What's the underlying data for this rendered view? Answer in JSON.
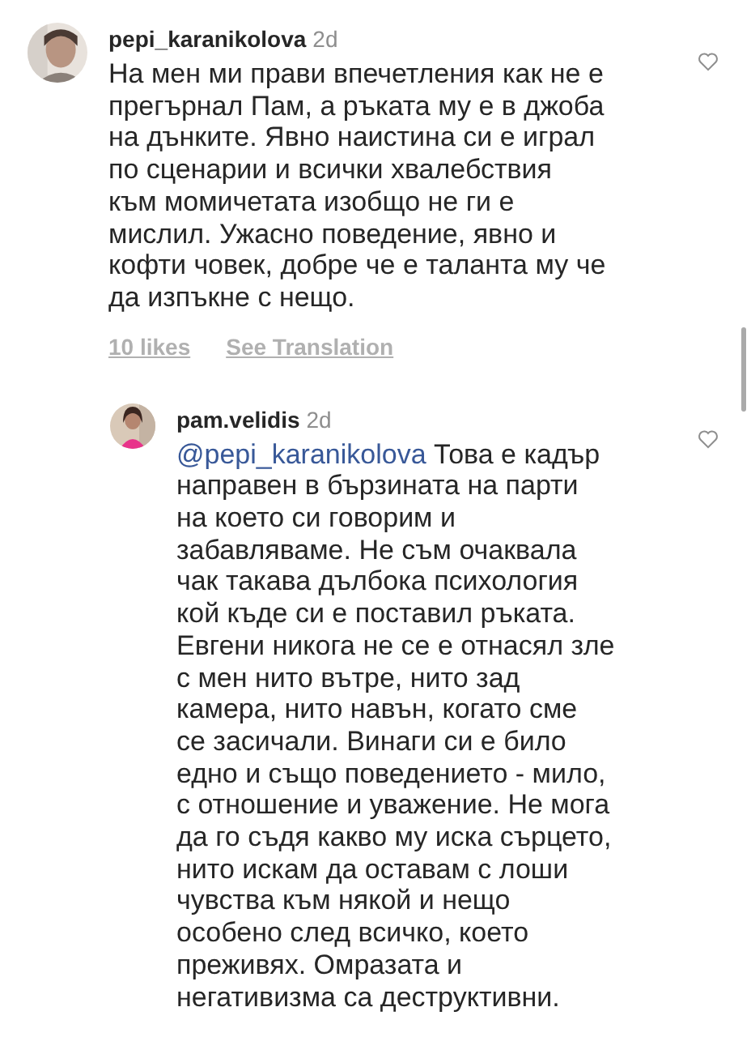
{
  "comments": [
    {
      "username": "pepi_karanikolova",
      "time": "2d",
      "lines": [
        "На мен ми прави впечетления как не е",
        "прегърнал Пам, а ръката му е в джоба",
        "на дънките. Явно наистина си е играл",
        "по сценарии и всички хвалебствия",
        "към момичетата изобщо не ги е",
        "мислил. Ужасно поведение, явно и",
        "кофти човек, добре че е таланта му че",
        "да изпъкне с нещо."
      ],
      "likes": "10 likes",
      "translation": "See Translation",
      "replies": [
        {
          "username": "pam.velidis",
          "time": "2d",
          "mention": "@pepi_karanikolova",
          "lines": [
            "Това е кадър",
            "направен в бързината на парти",
            "на което си говорим и",
            "забавляваме. Не съм очаквала",
            "чак такава дълбока психология",
            "кой къде си е поставил ръката.",
            "Евгени никога не се е отнасял зле",
            "с мен нито вътре, нито зад",
            "камера, нито навън, когато сме",
            "се засичали. Винаги си е било",
            "едно и също поведението - мило,",
            "с отношение и уважение. Не мога",
            "да го съдя какво му иска сърцето,",
            "нито искам да оставам с лоши",
            "чувства към някой и нещо",
            "особено след всичко, което",
            "преживях. Омразата и",
            "негативизма са деструктивни."
          ]
        }
      ]
    }
  ]
}
